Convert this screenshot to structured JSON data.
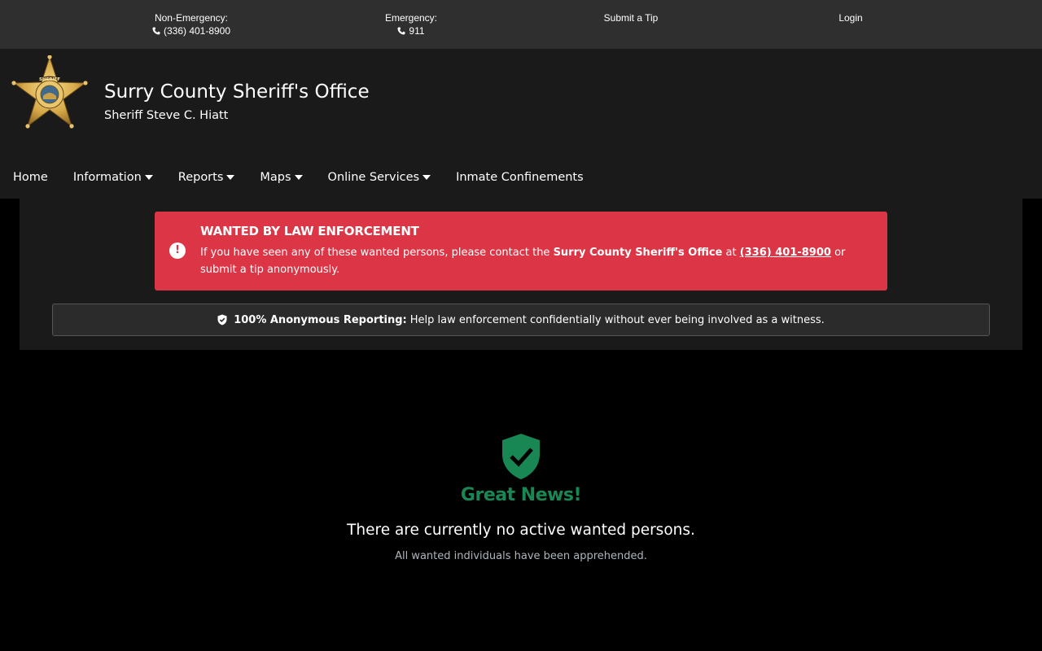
{
  "topbar": {
    "non_emergency_label": "Non-Emergency:",
    "non_emergency_phone": "(336) 401-8900",
    "emergency_label": "Emergency:",
    "emergency_phone": "911",
    "submit_tip": "Submit a Tip",
    "login": "Login"
  },
  "header": {
    "title": "Surry County Sheriff's Office",
    "subtitle": "Sheriff Steve C. Hiatt",
    "logo_text": "SHERIFF"
  },
  "nav": {
    "items": [
      {
        "label": "Home",
        "dropdown": false
      },
      {
        "label": "Information",
        "dropdown": true
      },
      {
        "label": "Reports",
        "dropdown": true
      },
      {
        "label": "Maps",
        "dropdown": true
      },
      {
        "label": "Online Services",
        "dropdown": true
      },
      {
        "label": "Inmate Confinements",
        "dropdown": false
      }
    ]
  },
  "alert": {
    "icon": "exclamation-circle-icon",
    "title": "WANTED BY LAW ENFORCEMENT",
    "body_prefix": "If you have seen any of these wanted persons, please contact the ",
    "body_org": "Surry County Sheriff's Office",
    "body_at": " at ",
    "body_phone": "(336) 401-8900",
    "body_suffix": " or submit a tip anonymously.",
    "color": "#dc3545"
  },
  "anonymous": {
    "icon": "shield-check-icon",
    "bold": "100% Anonymous Reporting:",
    "text": "Help law enforcement confidentially without ever being involved as a witness."
  },
  "status": {
    "icon": "shield-check-icon",
    "title": "Great News!",
    "message": "There are currently no active wanted persons.",
    "sub": "All wanted individuals have been apprehended.",
    "color": "#198754"
  }
}
